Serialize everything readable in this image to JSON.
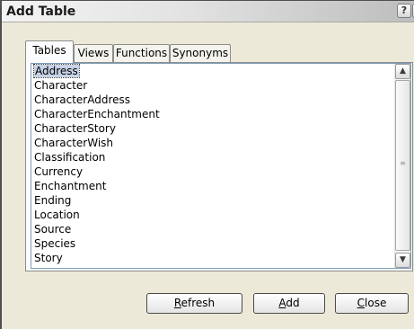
{
  "window": {
    "title": "Add Table",
    "help_glyph": "?",
    "close_glyph": "✕"
  },
  "tabs": [
    {
      "label": "Tables",
      "active": true
    },
    {
      "label": "Views",
      "active": false
    },
    {
      "label": "Functions",
      "active": false
    },
    {
      "label": "Synonyms",
      "active": false
    }
  ],
  "list": {
    "selected": "Address",
    "items": [
      "Address",
      "Character",
      "CharacterAddress",
      "CharacterEnchantment",
      "CharacterStory",
      "CharacterWish",
      "Classification",
      "Currency",
      "Enchantment",
      "Ending",
      "Location",
      "Source",
      "Species",
      "Story"
    ]
  },
  "buttons": {
    "refresh": {
      "mnemonic": "R",
      "rest": "efresh"
    },
    "add": {
      "mnemonic": "A",
      "rest": "dd"
    },
    "close": {
      "mnemonic": "C",
      "rest": "lose"
    }
  },
  "icons": {
    "help": "help-icon",
    "close": "close-icon",
    "scroll_up": "chevron-up-icon",
    "scroll_down": "chevron-down-icon"
  },
  "colors": {
    "dialog_bg": "#ece9d8",
    "selection": "#c6d3e6",
    "list_border": "#7f9db9"
  }
}
